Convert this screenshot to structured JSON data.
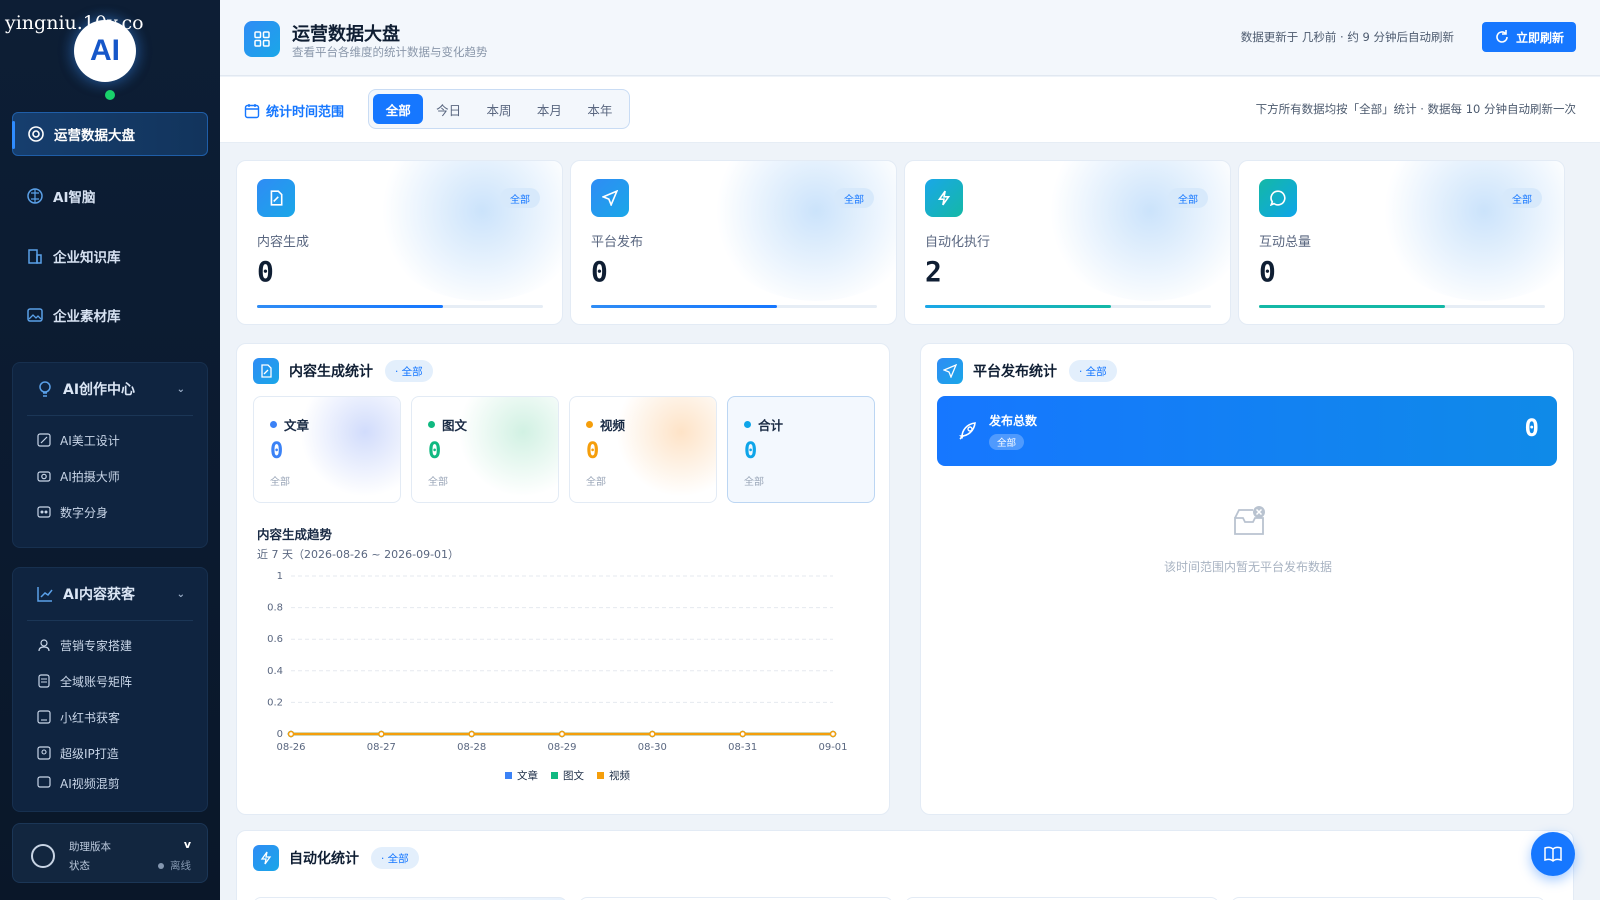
{
  "watermark": "yingniu.10v.co",
  "logo_text": "AI",
  "sidebar": {
    "items": [
      {
        "label": "运营数据大盘",
        "icon": "dashboard-icon",
        "active": true
      },
      {
        "label": "AI智脑",
        "icon": "brain-icon"
      },
      {
        "label": "企业知识库",
        "icon": "building-icon"
      },
      {
        "label": "企业素材库",
        "icon": "image-icon"
      }
    ],
    "groups": [
      {
        "label": "AI创作中心",
        "icon": "bulb-icon",
        "subs": [
          {
            "label": "AI美工设计",
            "icon": "design-icon"
          },
          {
            "label": "AI拍摄大师",
            "icon": "camera-icon"
          },
          {
            "label": "数字分身",
            "icon": "avatar-icon"
          }
        ]
      },
      {
        "label": "AI内容获客",
        "icon": "trend-icon",
        "subs": [
          {
            "label": "营销专家搭建",
            "icon": "user-icon"
          },
          {
            "label": "全域账号矩阵",
            "icon": "doc-icon"
          },
          {
            "label": "小红书获客",
            "icon": "ai-doc-icon"
          },
          {
            "label": "超级IP打造",
            "icon": "badge-icon"
          },
          {
            "label": "AI视频混剪",
            "icon": "video-icon"
          }
        ]
      }
    ],
    "assistant": {
      "version_label": "助理版本",
      "version_value": "v",
      "status_label": "状态",
      "status_value": "离线"
    }
  },
  "header": {
    "title": "运营数据大盘",
    "subtitle": "查看平台各维度的统计数据与变化趋势",
    "update_text": "数据更新于 几秒前 · 约 9 分钟后自动刷新",
    "refresh_label": "立即刷新"
  },
  "range": {
    "label": "统计时间范围",
    "tabs": [
      "全部",
      "今日",
      "本周",
      "本月",
      "本年"
    ],
    "active": "全部",
    "note": "下方所有数据均按「全部」统计 · 数据每 10 分钟自动刷新一次"
  },
  "kpis": [
    {
      "label": "内容生成",
      "value": "0",
      "tag": "全部",
      "icon": "file-edit-icon",
      "color": "#1677ff",
      "progress": 0.65
    },
    {
      "label": "平台发布",
      "value": "0",
      "tag": "全部",
      "icon": "send-icon",
      "color": "#1677ff",
      "progress": 0.65
    },
    {
      "label": "自动化执行",
      "value": "2",
      "tag": "全部",
      "icon": "bolt-icon",
      "color": "#14b8a6",
      "progress": 0.65
    },
    {
      "label": "互动总量",
      "value": "0",
      "tag": "全部",
      "icon": "chat-icon",
      "color": "#14b8a6",
      "progress": 0.65
    }
  ],
  "content_panel": {
    "title": "内容生成统计",
    "badge": "· 全部",
    "minis": [
      {
        "label": "文章",
        "value": "0",
        "sub": "全部",
        "color": "#3b82f6"
      },
      {
        "label": "图文",
        "value": "0",
        "sub": "全部",
        "color": "#10b981"
      },
      {
        "label": "视频",
        "value": "0",
        "sub": "全部",
        "color": "#f59e0b"
      },
      {
        "label": "合计",
        "value": "0",
        "sub": "全部",
        "color": "#0ea5e9"
      }
    ],
    "trend_title": "内容生成趋势",
    "trend_sub": "近 7 天（2026-08-26 ~ 2026-09-01）"
  },
  "chart_data": {
    "type": "line",
    "title": "内容生成趋势",
    "x": [
      "08-26",
      "08-27",
      "08-28",
      "08-29",
      "08-30",
      "08-31",
      "09-01"
    ],
    "ylim": [
      0,
      1
    ],
    "yticks": [
      "0",
      "0.2",
      "0.4",
      "0.6",
      "0.8",
      "1"
    ],
    "grid": true,
    "legend_position": "bottom",
    "series": [
      {
        "name": "文章",
        "values": [
          0,
          0,
          0,
          0,
          0,
          0,
          0
        ],
        "color": "#3b82f6"
      },
      {
        "name": "图文",
        "values": [
          0,
          0,
          0,
          0,
          0,
          0,
          0
        ],
        "color": "#10b981"
      },
      {
        "name": "视频",
        "values": [
          0,
          0,
          0,
          0,
          0,
          0,
          0
        ],
        "color": "#f59e0b"
      }
    ]
  },
  "publish_panel": {
    "title": "平台发布统计",
    "badge": "· 全部",
    "card_label": "发布总数",
    "card_badge": "全部",
    "card_value": "0",
    "empty_text": "该时间范围内暂无平台发布数据"
  },
  "auto_panel": {
    "title": "自动化统计",
    "badge": "· 全部"
  }
}
